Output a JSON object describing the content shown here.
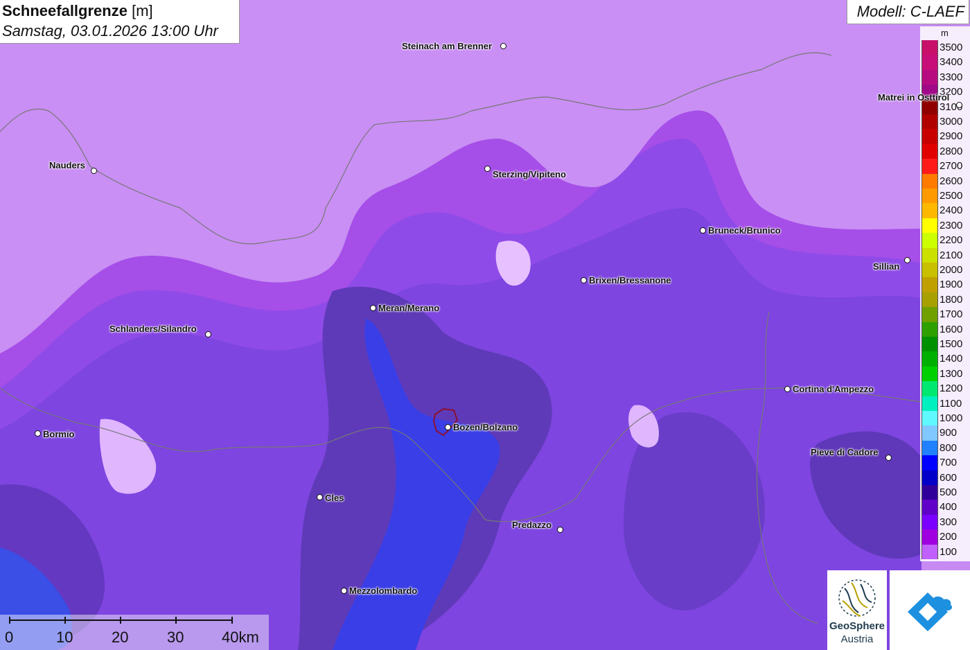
{
  "header": {
    "title_bold": "Schneefallgrenze",
    "title_unit": "[m]",
    "date": "Samstag, 03.01.2026 13:00 Uhr"
  },
  "model": {
    "label": "Modell: C-LAEF"
  },
  "legend": {
    "unit": "m",
    "entries": [
      {
        "label": "3500",
        "color": "#c8106a"
      },
      {
        "label": "3400",
        "color": "#c80e78"
      },
      {
        "label": "3300",
        "color": "#b80a80"
      },
      {
        "label": "3200",
        "color": "#a00888"
      },
      {
        "label": "3100",
        "color": "#900000"
      },
      {
        "label": "3000",
        "color": "#b00000"
      },
      {
        "label": "2900",
        "color": "#c80000"
      },
      {
        "label": "2800",
        "color": "#e00000"
      },
      {
        "label": "2700",
        "color": "#ff1a1a"
      },
      {
        "label": "2600",
        "color": "#ff7a00"
      },
      {
        "label": "2500",
        "color": "#ff9a00"
      },
      {
        "label": "2400",
        "color": "#ffb800"
      },
      {
        "label": "2300",
        "color": "#ffff00"
      },
      {
        "label": "2200",
        "color": "#ccff00"
      },
      {
        "label": "2100",
        "color": "#cce000"
      },
      {
        "label": "2000",
        "color": "#c8c000"
      },
      {
        "label": "1900",
        "color": "#c0a000"
      },
      {
        "label": "1800",
        "color": "#a8a000"
      },
      {
        "label": "1700",
        "color": "#70a000"
      },
      {
        "label": "1600",
        "color": "#2ea000"
      },
      {
        "label": "1500",
        "color": "#009000"
      },
      {
        "label": "1400",
        "color": "#00b000"
      },
      {
        "label": "1300",
        "color": "#00d000"
      },
      {
        "label": "1200",
        "color": "#00e870"
      },
      {
        "label": "1100",
        "color": "#00f0c0"
      },
      {
        "label": "1000",
        "color": "#60f8ff"
      },
      {
        "label": "900",
        "color": "#80c8ff"
      },
      {
        "label": "800",
        "color": "#2080ff"
      },
      {
        "label": "700",
        "color": "#0000ff"
      },
      {
        "label": "600",
        "color": "#0000c8"
      },
      {
        "label": "500",
        "color": "#30009a"
      },
      {
        "label": "400",
        "color": "#6000c8"
      },
      {
        "label": "300",
        "color": "#7a00ff"
      },
      {
        "label": "200",
        "color": "#a000e0"
      },
      {
        "label": "100",
        "color": "#c060ff"
      }
    ]
  },
  "cities": [
    {
      "name": "Steinach am Brenner",
      "icon": "city-dot-icon"
    },
    {
      "name": "Nauders",
      "icon": "city-dot-icon"
    },
    {
      "name": "Sterzing/Vipiteno",
      "icon": "city-dot-icon"
    },
    {
      "name": "Matrei in Osttirol",
      "icon": "city-dot-icon"
    },
    {
      "name": "Bruneck/Brunico",
      "icon": "city-dot-icon"
    },
    {
      "name": "Sillian",
      "icon": "city-dot-icon"
    },
    {
      "name": "Brixen/Bressanone",
      "icon": "city-dot-icon"
    },
    {
      "name": "Meran/Merano",
      "icon": "city-dot-icon"
    },
    {
      "name": "Schlanders/Silandro",
      "icon": "city-dot-icon"
    },
    {
      "name": "Cortina d'Ampezzo",
      "icon": "city-dot-icon"
    },
    {
      "name": "Bormio",
      "icon": "city-dot-icon"
    },
    {
      "name": "Bozen/Bolzano",
      "icon": "city-dot-icon"
    },
    {
      "name": "Pieve di Cadore",
      "icon": "city-dot-icon"
    },
    {
      "name": "Cles",
      "icon": "city-dot-icon"
    },
    {
      "name": "Predazzo",
      "icon": "city-dot-icon"
    },
    {
      "name": "Mezzolombardo",
      "icon": "city-dot-icon"
    }
  ],
  "scalebar": {
    "labels": [
      "0",
      "10",
      "20",
      "30",
      "40km"
    ]
  },
  "logos": {
    "geosphere_line1": "GeoSphere",
    "geosphere_line2": "Austria"
  }
}
